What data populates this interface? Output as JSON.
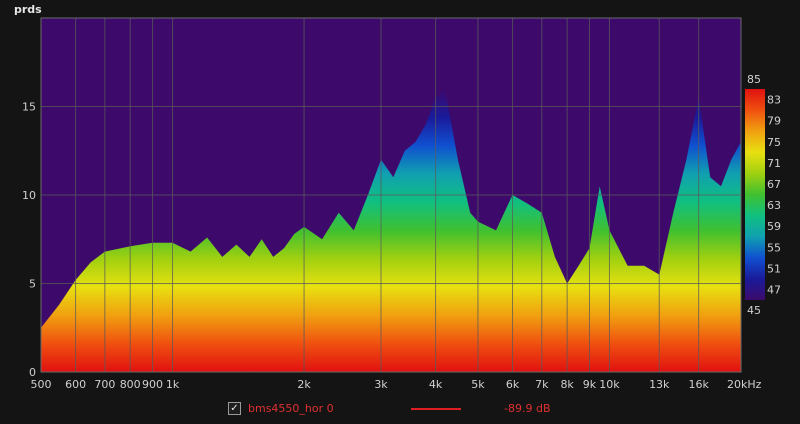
{
  "chart_data": {
    "type": "heatmap",
    "title": "",
    "xlabel": "",
    "ylabel": "prds",
    "x_scale": "log",
    "xlim": [
      500,
      20000
    ],
    "ylim": [
      0,
      20
    ],
    "x_ticks": [
      500,
      600,
      700,
      800,
      900,
      1000,
      2000,
      3000,
      4000,
      5000,
      6000,
      7000,
      8000,
      9000,
      10000,
      13000,
      16000,
      20000
    ],
    "x_tick_labels": [
      "500",
      "600",
      "700",
      "800",
      "900",
      "1k",
      "2k",
      "3k",
      "4k",
      "5k",
      "6k",
      "7k",
      "8k",
      "9k",
      "10k",
      "13k",
      "16k",
      "20kHz"
    ],
    "y_ticks": [
      0,
      5,
      10,
      15
    ],
    "y_tick_labels": [
      "0",
      "5",
      "10",
      "15"
    ],
    "grid": true,
    "colorbar": {
      "min": 45,
      "max": 85,
      "labels": [
        "85",
        "83",
        "79",
        "75",
        "71",
        "67",
        "63",
        "59",
        "55",
        "51",
        "47",
        "45"
      ],
      "label_values": [
        85,
        83,
        79,
        75,
        71,
        67,
        63,
        59,
        55,
        51,
        47,
        45
      ],
      "colors": [
        "#3d0a6b",
        "#1a1a9a",
        "#1050d0",
        "#10a0b0",
        "#10c080",
        "#40c030",
        "#a0d010",
        "#e8e010",
        "#f0a010",
        "#f05010",
        "#e01010"
      ]
    },
    "decay_edge": {
      "x": [
        500,
        550,
        600,
        650,
        700,
        800,
        900,
        1000,
        1100,
        1200,
        1300,
        1400,
        1500,
        1600,
        1700,
        1800,
        1900,
        2000,
        2200,
        2400,
        2600,
        2800,
        3000,
        3200,
        3400,
        3600,
        3800,
        4000,
        4200,
        4500,
        4800,
        5000,
        5500,
        6000,
        6500,
        7000,
        7500,
        8000,
        8500,
        9000,
        9500,
        10000,
        11000,
        12000,
        13000,
        14000,
        15000,
        16000,
        17000,
        18000,
        19000,
        20000
      ],
      "y": [
        2.5,
        3.8,
        5.2,
        6.2,
        6.8,
        7.1,
        7.3,
        7.3,
        6.8,
        7.6,
        6.5,
        7.2,
        6.5,
        7.5,
        6.5,
        7.0,
        7.8,
        8.2,
        7.5,
        9.0,
        8.0,
        10.0,
        12.0,
        11.0,
        12.5,
        13.0,
        14.0,
        15.5,
        16.0,
        12.0,
        9.0,
        8.5,
        8.0,
        10.0,
        9.5,
        9.0,
        6.5,
        5.0,
        6.0,
        7.0,
        10.5,
        8.0,
        6.0,
        6.0,
        5.5,
        9.0,
        12.0,
        15.5,
        11.0,
        10.5,
        12.0,
        13.0
      ]
    },
    "series": [
      {
        "name": "bms4550_hor 0",
        "value_label": "-89.9 dB",
        "color": "#e02020",
        "checked": true
      }
    ]
  },
  "legend": {
    "checkbox": "✓",
    "name": "bms4550_hor 0",
    "value": "-89.9 dB"
  }
}
